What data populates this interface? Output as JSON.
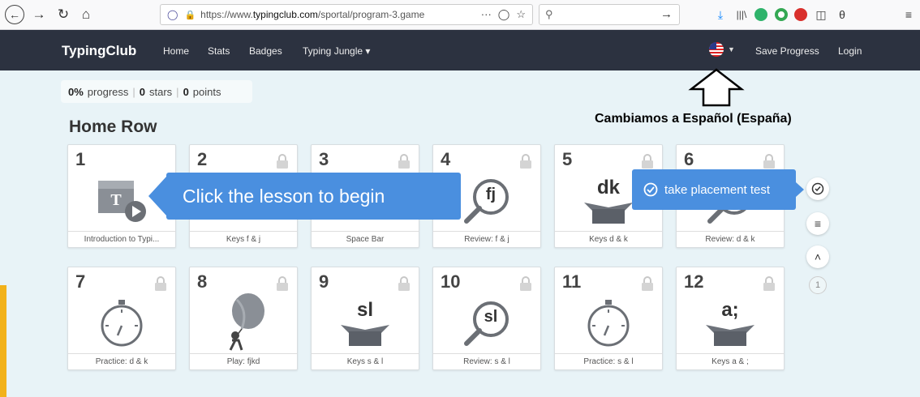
{
  "browser": {
    "url_prefix": "https://www.",
    "url_domain": "typingclub.com",
    "url_path": "/sportal/program-3.game",
    "url_more": "···",
    "search_placeholder": ""
  },
  "navbar": {
    "brand": "TypingClub",
    "links": [
      "Home",
      "Stats",
      "Badges",
      "Typing Jungle ▾"
    ],
    "save_progress": "Save Progress",
    "login": "Login"
  },
  "progress": {
    "percent": "0%",
    "percent_label": "progress",
    "stars": "0",
    "stars_label": "stars",
    "points": "0",
    "points_label": "points"
  },
  "section_title": "Home Row",
  "annotation": "Cambiamos a Español (España)",
  "tooltip": "Click the lesson to begin",
  "placement_test": "take placement test",
  "page_indicator": "1",
  "lessons": [
    {
      "num": "1",
      "title": "Introduction to Typi...",
      "locked": false,
      "art": "video"
    },
    {
      "num": "2",
      "title": "Keys f & j",
      "locked": true,
      "art": "box"
    },
    {
      "num": "3",
      "title": "Space Bar",
      "locked": true,
      "art": "box"
    },
    {
      "num": "4",
      "title": "Review: f & j",
      "locked": true,
      "art": "magnifier",
      "label": "fj"
    },
    {
      "num": "5",
      "title": "Keys d & k",
      "locked": true,
      "art": "box",
      "label": "dk"
    },
    {
      "num": "6",
      "title": "Review: d & k",
      "locked": true,
      "art": "magnifier"
    },
    {
      "num": "7",
      "title": "Practice: d & k",
      "locked": true,
      "art": "stopwatch"
    },
    {
      "num": "8",
      "title": "Play: fjkd",
      "locked": true,
      "art": "balloon"
    },
    {
      "num": "9",
      "title": "Keys s & l",
      "locked": true,
      "art": "box",
      "label": "sl"
    },
    {
      "num": "10",
      "title": "Review: s & l",
      "locked": true,
      "art": "magnifier",
      "label": "sl"
    },
    {
      "num": "11",
      "title": "Practice: s & l",
      "locked": true,
      "art": "stopwatch"
    },
    {
      "num": "12",
      "title": "Keys a & ;",
      "locked": true,
      "art": "box",
      "label": "a;"
    }
  ]
}
